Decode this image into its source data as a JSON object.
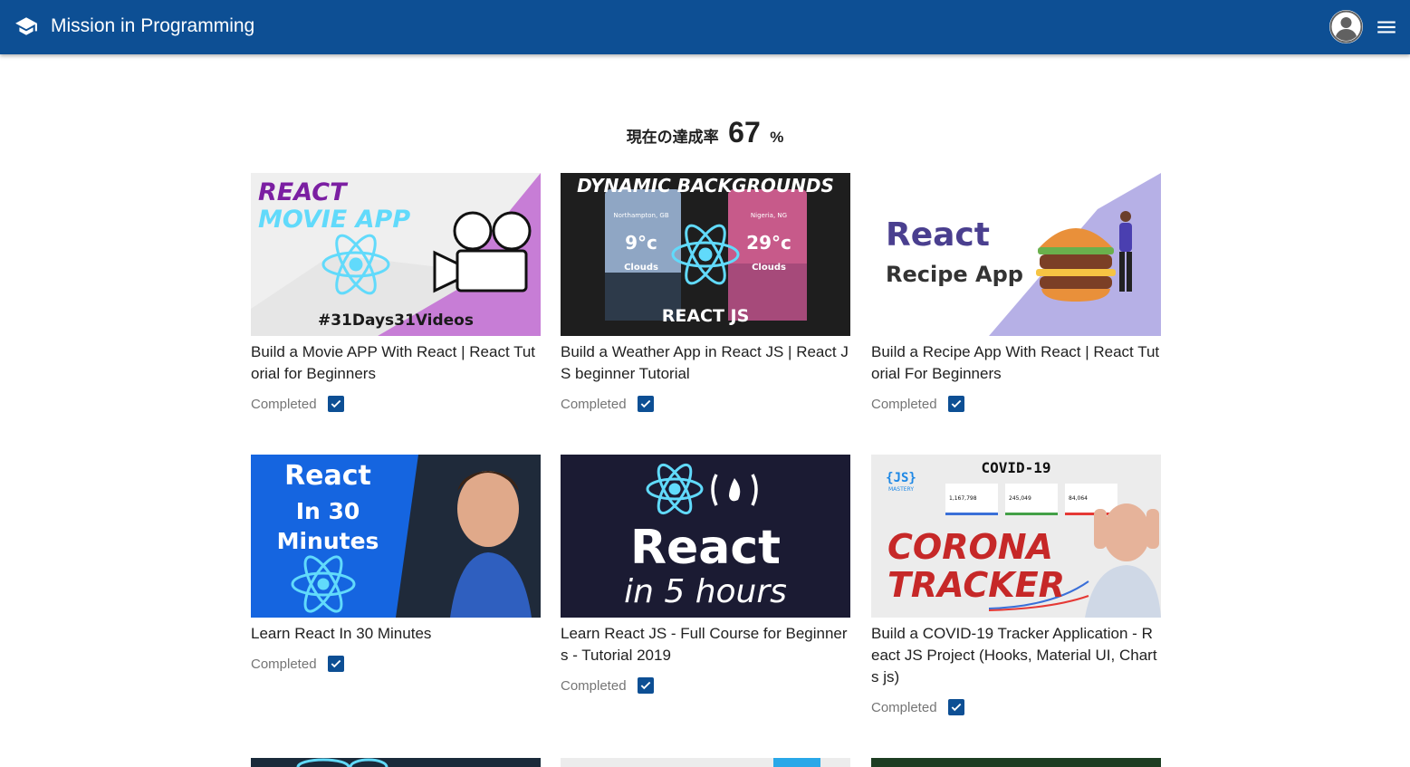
{
  "app": {
    "title": "Mission in Programming",
    "brand_color": "#0d4f94",
    "logo_icon": "graduation-cap-icon",
    "avatar_icon": "account-circle-icon",
    "menu_icon": "hamburger-menu-icon"
  },
  "progress": {
    "label": "現在の達成率",
    "value": "67",
    "unit": "%"
  },
  "videos": [
    {
      "title": "Build a Movie APP With React | React Tutorial for Beginners",
      "status": "Completed",
      "checked": true,
      "thumb": {
        "line1": "REACT",
        "line2": "MOVIE APP",
        "tag": "#31Days31Videos"
      }
    },
    {
      "title": "Build a Weather App in React JS | React JS beginner Tutorial",
      "status": "Completed",
      "checked": true,
      "thumb": {
        "heading": "DYNAMIC BACKGROUNDS",
        "left_city": "Northampton, GB",
        "left_temp": "9°c",
        "left_cond": "Clouds",
        "right_city": "Nigeria, NG",
        "right_temp": "29°c",
        "right_cond": "Clouds",
        "footer": "REACT JS"
      }
    },
    {
      "title": "Build a Recipe App With React | React Tutorial For Beginners",
      "status": "Completed",
      "checked": true,
      "thumb": {
        "line1": "React",
        "line2": "Recipe App"
      }
    },
    {
      "title": "Learn React In 30 Minutes",
      "status": "Completed",
      "checked": true,
      "thumb": {
        "line1": "React",
        "line2": "In 30",
        "line3": "Minutes"
      }
    },
    {
      "title": "Learn React JS - Full Course for Beginners - Tutorial 2019",
      "status": "Completed",
      "checked": true,
      "thumb": {
        "line1": "React",
        "line2": "in 5 hours"
      }
    },
    {
      "title": "Build a COVID-19 Tracker Application - React JS Project (Hooks, Material UI, Charts js)",
      "status": "Completed",
      "checked": true,
      "thumb": {
        "heading": "COVID-19",
        "badge": "{JS}",
        "badge_sub": "MASTERY",
        "line1": "CORONA",
        "line2": "TRACKER",
        "stat1": "1,167,798",
        "stat2": "245,049",
        "stat3": "84,064"
      }
    }
  ]
}
